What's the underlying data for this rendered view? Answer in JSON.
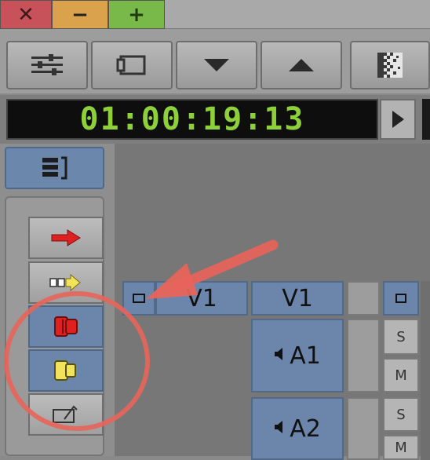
{
  "window": {
    "close_glyph": "✕",
    "minimize_glyph": "−",
    "maximize_glyph": "+"
  },
  "toolbar": {
    "buttons": [
      {
        "icon": "sliders-icon"
      },
      {
        "icon": "monitor-frame-icon"
      },
      {
        "icon": "triangle-down-icon"
      },
      {
        "icon": "triangle-up-icon"
      },
      {
        "icon": "checker-fade-icon"
      }
    ]
  },
  "timecode": {
    "value": "01:00:19:13"
  },
  "tracks": {
    "source": {
      "v1": "V1"
    },
    "record": {
      "v1": "V1",
      "a1": "A1",
      "a2": "A2"
    },
    "solo_label": "S",
    "mute_label": "M"
  },
  "colors": {
    "timecode_text": "#8dd03a",
    "selected_blue": "#6b86aa",
    "annotation": "#e8645a",
    "close": "#c8525a",
    "minimize": "#d9a24b",
    "maximize": "#79b94a"
  }
}
